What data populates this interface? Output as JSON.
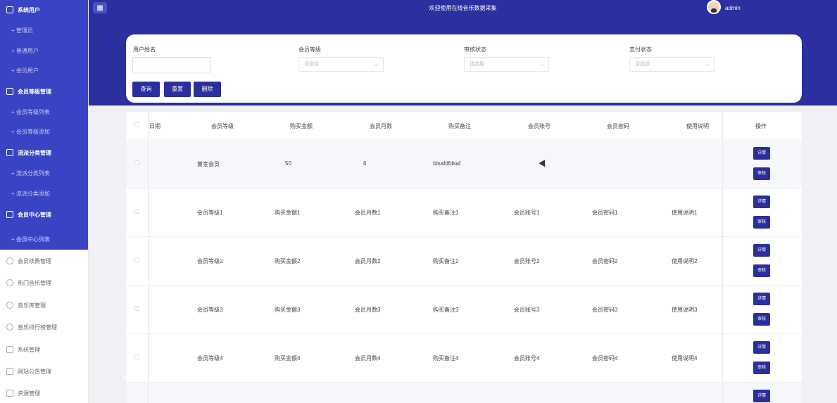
{
  "header": {
    "title": "欢迎使用在线音乐数据采集",
    "user": "admin"
  },
  "sidebar": {
    "items": [
      {
        "label": "系统用户",
        "type": "group"
      },
      {
        "label": "+ 管理员",
        "type": "sub"
      },
      {
        "label": "+ 普通用户",
        "type": "sub"
      },
      {
        "label": "+ 会员用户",
        "type": "sub"
      },
      {
        "label": "会员等级管理",
        "type": "group"
      },
      {
        "label": "+ 会员等级列表",
        "type": "sub"
      },
      {
        "label": "+ 会员等级添加",
        "type": "sub"
      },
      {
        "label": "流派分类管理",
        "type": "group"
      },
      {
        "label": "+ 流派分类列表",
        "type": "sub"
      },
      {
        "label": "+ 流派分类添加",
        "type": "sub"
      },
      {
        "label": "会员中心管理",
        "type": "group"
      },
      {
        "label": "+ 会员中心列表",
        "type": "active"
      },
      {
        "label": "会员续费管理",
        "type": "light"
      },
      {
        "label": "热门音乐管理",
        "type": "light"
      },
      {
        "label": "音乐库管理",
        "type": "light"
      },
      {
        "label": "音乐排行榜管理",
        "type": "light"
      },
      {
        "label": "系统管理",
        "type": "light"
      },
      {
        "label": "网站公告管理",
        "type": "light"
      },
      {
        "label": "资源管理",
        "type": "light"
      }
    ]
  },
  "search": {
    "username_label": "用户姓名",
    "level_label": "会员等级",
    "level_placeholder": "请选择",
    "audit_label": "审核状态",
    "audit_placeholder": "请选择",
    "pay_label": "支付状态",
    "pay_placeholder": "请选择",
    "query_btn": "查询",
    "reset_btn": "重置",
    "delete_btn": "删除"
  },
  "table": {
    "columns": [
      "日期",
      "会员等级",
      "购买金额",
      "会员月数",
      "购买备注",
      "会员账号",
      "会员密码",
      "使用说明",
      "操作"
    ],
    "rows": [
      [
        "黄金会员",
        "50",
        "6",
        "fdsafdfdsaf",
        "",
        "",
        ""
      ],
      [
        "会员等级1",
        "购买金额1",
        "会员月数1",
        "购买备注1",
        "会员账号1",
        "会员密码1",
        "使用说明1"
      ],
      [
        "会员等级2",
        "购买金额2",
        "会员月数2",
        "购买备注2",
        "会员账号2",
        "会员密码2",
        "使用说明2"
      ],
      [
        "会员等级3",
        "购买金额3",
        "会员月数3",
        "购买备注3",
        "会员账号3",
        "会员密码3",
        "使用说明3"
      ],
      [
        "会员等级4",
        "购买金额4",
        "会员月数4",
        "购买备注4",
        "会员账号4",
        "会员密码4",
        "使用说明4"
      ]
    ],
    "detail_btn": "详情",
    "audit_btn": "审核"
  },
  "colors": {
    "sidebar_active_bg": "#3a43c3",
    "header_bg": "#2b2f9f",
    "button_bg": "#2a2f9e"
  }
}
